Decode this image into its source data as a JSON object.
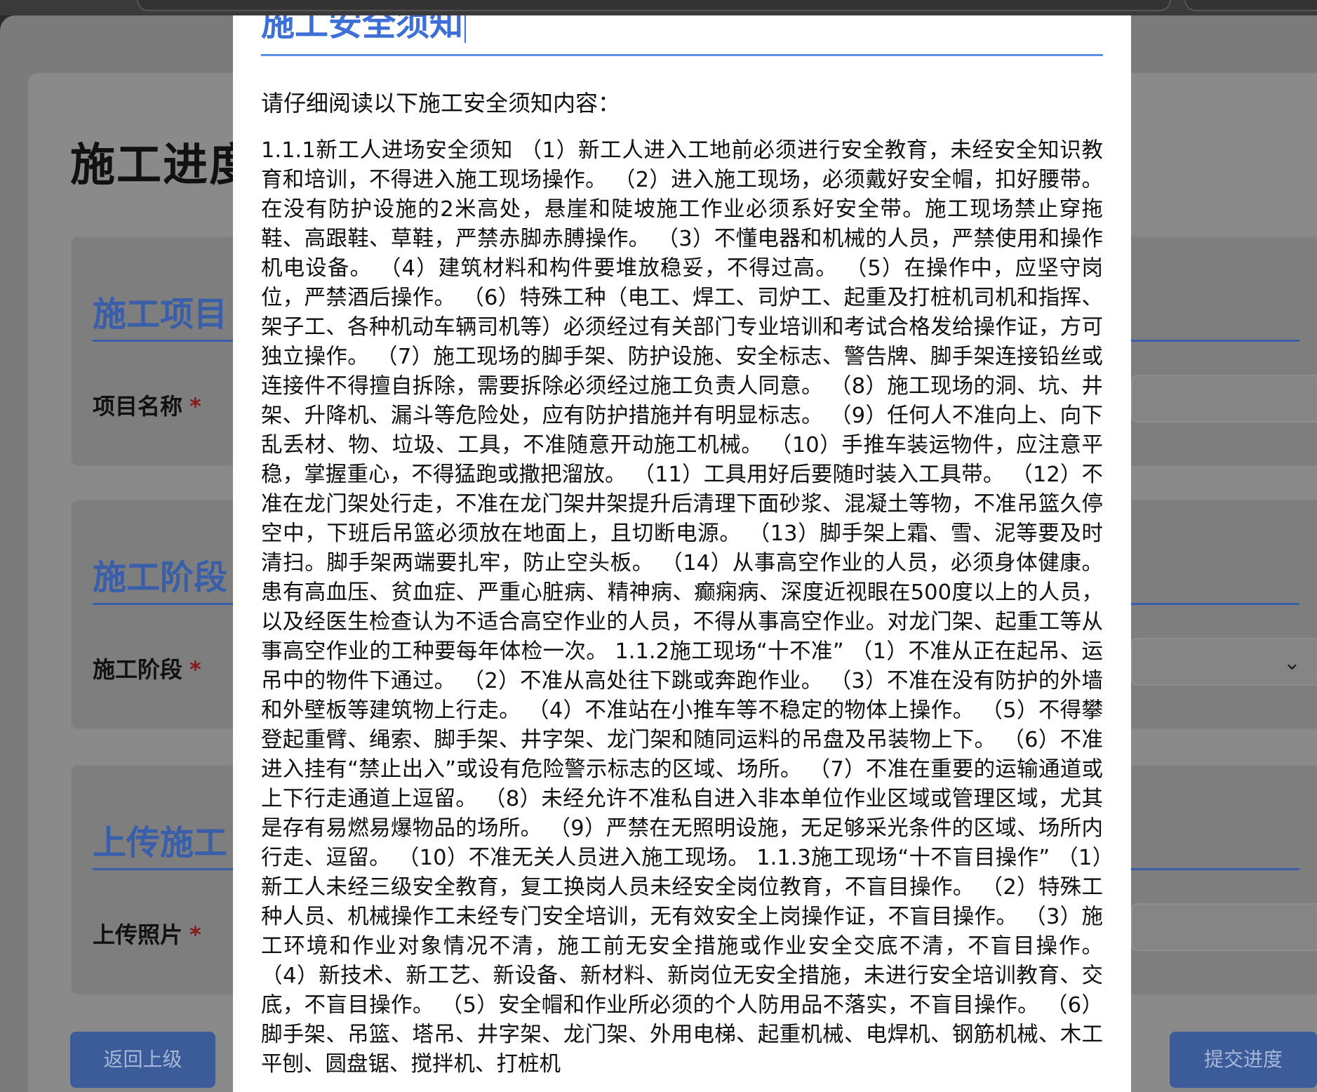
{
  "page": {
    "title": "施工进度",
    "sections": [
      {
        "title": "施工项目",
        "field_label": "项目名称",
        "required_mark": "*"
      },
      {
        "title": "施工阶段",
        "field_label": "施工阶段",
        "required_mark": "*"
      },
      {
        "title": "上传施工",
        "field_label": "上传照片",
        "required_mark": "*"
      }
    ],
    "back_button": "返回上级",
    "submit_button": "提交进度"
  },
  "modal": {
    "title": "施工安全须知",
    "intro": "请仔细阅读以下施工安全须知内容：",
    "content": "1.1.1新工人进场安全须知 （1）新工人进入工地前必须进行安全教育，未经安全知识教育和培训，不得进入施工现场操作。 （2）进入施工现场，必须戴好安全帽，扣好腰带。在没有防护设施的2米高处，悬崖和陡坡施工作业必须系好安全带。施工现场禁止穿拖鞋、高跟鞋、草鞋，严禁赤脚赤膊操作。 （3）不懂电器和机械的人员，严禁使用和操作机电设备。 （4）建筑材料和构件要堆放稳妥，不得过高。 （5）在操作中，应坚守岗位，严禁酒后操作。 （6）特殊工种（电工、焊工、司炉工、起重及打桩机司机和指挥、架子工、各种机动车辆司机等）必须经过有关部门专业培训和考试合格发给操作证，方可独立操作。 （7）施工现场的脚手架、防护设施、安全标志、警告牌、脚手架连接铅丝或连接件不得擅自拆除，需要拆除必须经过施工负责人同意。 （8）施工现场的洞、坑、井架、升降机、漏斗等危险处，应有防护措施并有明显标志。 （9）任何人不准向上、向下乱丢材、物、垃圾、工具，不准随意开动施工机械。 （10）手推车装运物件，应注意平稳，掌握重心，不得猛跑或撒把溜放。 （11）工具用好后要随时装入工具带。 （12）不准在龙门架处行走，不准在龙门架井架提升后清理下面砂浆、混凝土等物，不准吊篮久停空中，下班后吊篮必须放在地面上，且切断电源。 （13）脚手架上霜、雪、泥等要及时清扫。脚手架两端要扎牢，防止空头板。 （14）从事高空作业的人员，必须身体健康。患有高血压、贫血症、严重心脏病、精神病、癫痫病、深度近视眼在500度以上的人员，以及经医生检查认为不适合高空作业的人员，不得从事高空作业。对龙门架、起重工等从事高空作业的工种要每年体检一次。 1.1.2施工现场“十不准” （1）不准从正在起吊、运吊中的物件下通过。 （2）不准从高处往下跳或奔跑作业。 （3）不准在没有防护的外墙和外壁板等建筑物上行走。 （4）不准站在小推车等不稳定的物体上操作。 （5）不得攀登起重臂、绳索、脚手架、井字架、龙门架和随同运料的吊盘及吊装物上下。 （6）不准进入挂有“禁止出入”或设有危险警示标志的区域、场所。 （7）不准在重要的运输通道或上下行走通道上逗留。 （8）未经允许不准私自进入非本单位作业区域或管理区域，尤其是存有易燃易爆物品的场所。 （9）严禁在无照明设施，无足够采光条件的区域、场所内行走、逗留。 （10）不准无关人员进入施工现场。 1.1.3施工现场“十不盲目操作” （1）新工人未经三级安全教育，复工换岗人员未经安全岗位教育，不盲目操作。 （2）特殊工种人员、机械操作工未经专门安全培训，无有效安全上岗操作证，不盲目操作。 （3）施工环境和作业对象情况不清，施工前无安全措施或作业安全交底不清，不盲目操作。 （4）新技术、新工艺、新设备、新材料、新岗位无安全措施，未进行安全培训教育、交底，不盲目操作。 （5）安全帽和作业所必须的个人防用品不落实，不盲目操作。 （6）脚手架、吊篮、塔吊、井字架、龙门架、外用电梯、起重机械、电焊机、钢筋机械、木工平刨、圆盘锯、搅拌机、打桩机"
  }
}
